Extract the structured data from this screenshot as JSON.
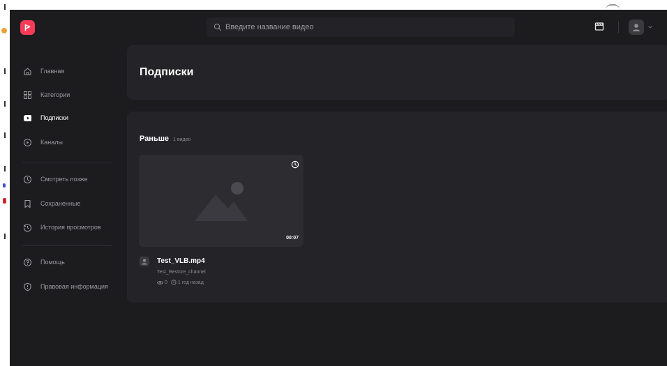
{
  "colors": {
    "accent": "#f53b57",
    "background": "#1c1c1f",
    "panel": "#242428",
    "muted_text": "#9a9aa0"
  },
  "header": {
    "search_placeholder": "Введите название видео",
    "logo_icon": "play-flag-logo",
    "upload_icon": "clapperboard-icon",
    "avatar_icon": "user-icon"
  },
  "sidebar": {
    "items": [
      {
        "label": "Главная",
        "icon": "home-icon"
      },
      {
        "label": "Категории",
        "icon": "grid-icon"
      },
      {
        "label": "Подписки",
        "icon": "subscriptions-icon",
        "active": true
      },
      {
        "label": "Каналы",
        "icon": "play-circle-icon"
      },
      {
        "label": "Смотреть позже",
        "icon": "clock-icon"
      },
      {
        "label": "Сохраненные",
        "icon": "bookmark-icon"
      },
      {
        "label": "История просмотров",
        "icon": "history-icon"
      },
      {
        "label": "Помощь",
        "icon": "help-icon"
      },
      {
        "label": "Правовая информация",
        "icon": "shield-icon"
      }
    ]
  },
  "main": {
    "page_title": "Подписки",
    "section": {
      "title": "Раньше",
      "count": "1 видео",
      "videos": [
        {
          "title": "Test_VLB.mp4",
          "channel": "Test_Restore_channel",
          "duration": "00:07",
          "views": "0",
          "age": "1 год назад"
        }
      ]
    }
  }
}
